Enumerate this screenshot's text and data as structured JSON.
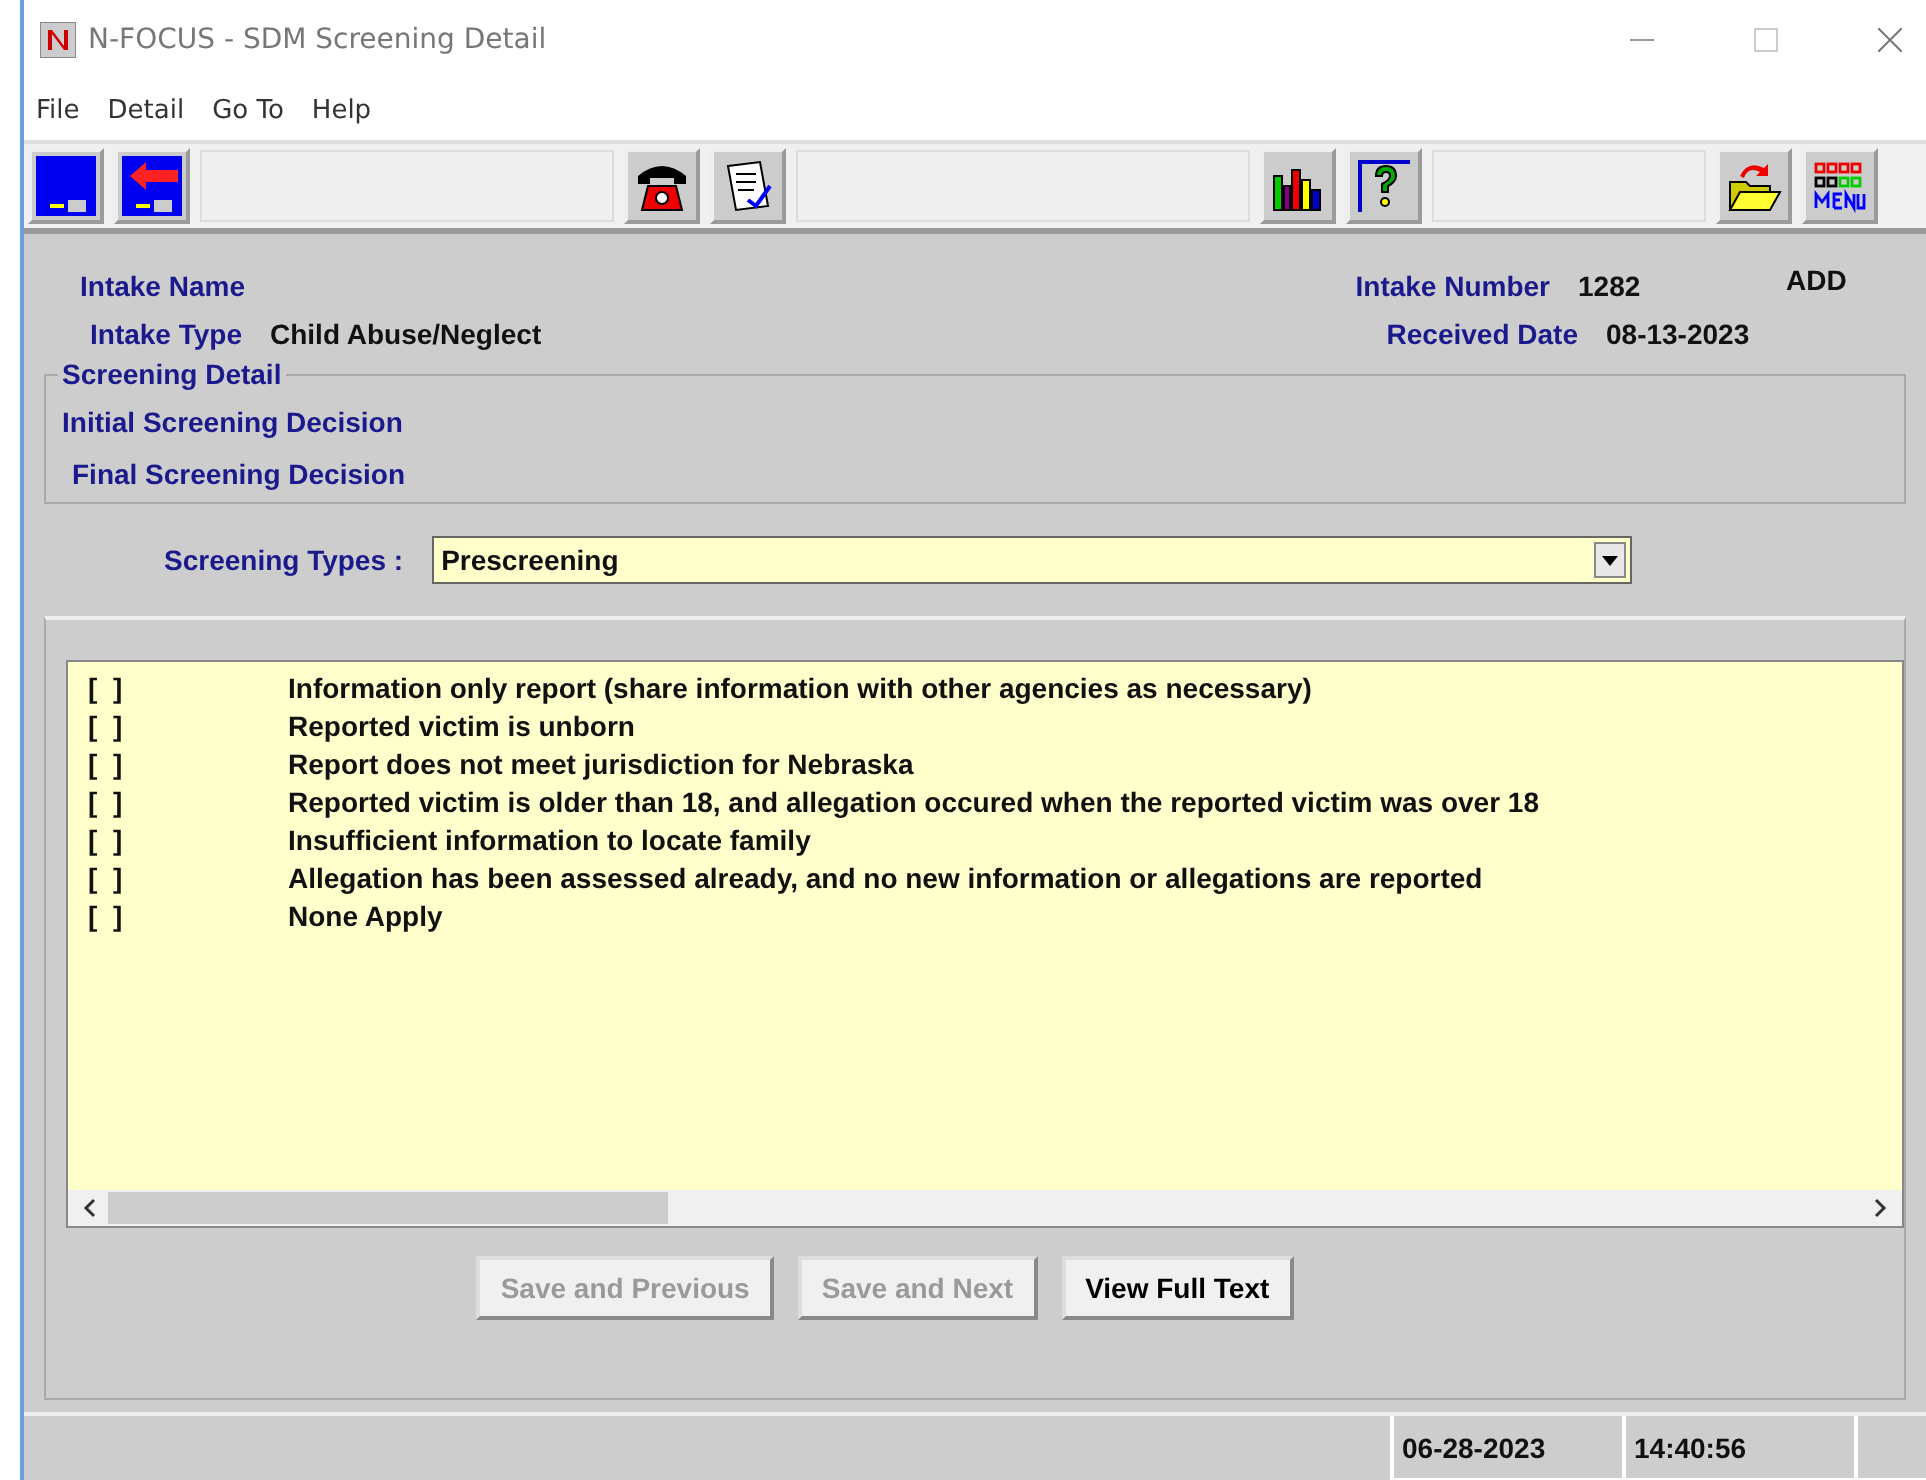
{
  "window": {
    "title": "N-FOCUS - SDM Screening Detail"
  },
  "menu": [
    "File",
    "Detail",
    "Go To",
    "Help"
  ],
  "header": {
    "intake_name_label": "Intake Name",
    "intake_type_label": "Intake Type",
    "intake_type": "Child Abuse/Neglect",
    "intake_number_label": "Intake Number",
    "intake_number": "1282",
    "mode": "ADD",
    "received_date_label": "Received Date",
    "received_date": "08-13-2023"
  },
  "screening_detail": {
    "legend": "Screening Detail",
    "initial_label": "Initial Screening Decision",
    "final_label": "Final Screening Decision"
  },
  "screening_types": {
    "label": "Screening Types :",
    "value": "Prescreening"
  },
  "items": [
    {
      "box": "[  ]",
      "text": "Information only report (share information with other agencies as necessary)"
    },
    {
      "box": "[  ]",
      "text": "Reported victim is unborn"
    },
    {
      "box": "[  ]",
      "text": "Report does not meet jurisdiction for Nebraska"
    },
    {
      "box": "[  ]",
      "text": "Reported victim is older than 18, and allegation occured when the reported victim was over 18"
    },
    {
      "box": "[  ]",
      "text": "Insufficient information to locate family"
    },
    {
      "box": "[  ]",
      "text": "Allegation has been assessed already, and no new information or allegations are reported"
    },
    {
      "box": "[  ]",
      "text": "None Apply"
    }
  ],
  "buttons": [
    {
      "label": "Save and Previous",
      "disabled": true
    },
    {
      "label": "Save and Next",
      "disabled": true
    },
    {
      "label": "View Full Text",
      "disabled": false
    }
  ],
  "status_bar": {
    "date": "06-28-2023",
    "time": "14:40:56"
  }
}
